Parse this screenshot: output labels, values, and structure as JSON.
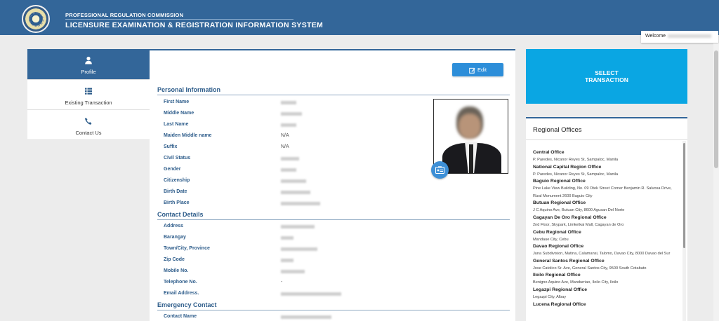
{
  "header": {
    "org_small": "PROFESSIONAL REGULATION COMMISSION",
    "org_big": "LICENSURE EXAMINATION & REGISTRATION INFORMATION SYSTEM",
    "welcome": "Welcome"
  },
  "nav": {
    "items": [
      {
        "label": "Profile",
        "icon": "user-icon"
      },
      {
        "label": "Existing Transaction",
        "icon": "list-icon"
      },
      {
        "label": "Contact Us",
        "icon": "phone-icon"
      }
    ]
  },
  "main": {
    "edit_label": "Edit",
    "personal_title": "Personal Information",
    "personal": [
      {
        "key": "First Name",
        "value": ""
      },
      {
        "key": "Middle Name",
        "value": ""
      },
      {
        "key": "Last Name",
        "value": ""
      },
      {
        "key": "Maiden Middle name",
        "value": "N/A"
      },
      {
        "key": "Suffix",
        "value": "N/A"
      },
      {
        "key": "Civil Status",
        "value": ""
      },
      {
        "key": "Gender",
        "value": ""
      },
      {
        "key": "Citizenship",
        "value": ""
      },
      {
        "key": "Birth Date",
        "value": ""
      },
      {
        "key": "Birth Place",
        "value": ""
      }
    ],
    "contact_title": "Contact Details",
    "contact": [
      {
        "key": "Address",
        "value": ""
      },
      {
        "key": "Barangay",
        "value": ""
      },
      {
        "key": "Town/City, Province",
        "value": ""
      },
      {
        "key": "Zip Code",
        "value": ""
      },
      {
        "key": "Mobile No.",
        "value": ""
      },
      {
        "key": "Telephone No.",
        "value": "-"
      },
      {
        "key": "Email Address.",
        "value": ""
      }
    ],
    "emergency_title": "Emergency Contact",
    "emergency": [
      {
        "key": "Contact Name",
        "value": ""
      }
    ]
  },
  "right": {
    "select_line1": "SELECT",
    "select_line2": "TRANSACTION",
    "regional_title": "Regional Offices",
    "offices": [
      {
        "name": "Central Office",
        "address": "P. Paredes, Nicanor Reyes St, Sampaloc, Manila"
      },
      {
        "name": "National Capital Region Office",
        "address": "P. Paredes, Nicanor Reyes St, Sampaloc, Manila"
      },
      {
        "name": "Baguio Regional Office",
        "address": "Pine Lake View Building, No. 09 Otek Street Corner Benjamin R. Salvosa Drive, Rizal Monument 2600 Baguio City"
      },
      {
        "name": "Butuan Regional Office",
        "address": "J C Aquino Ave, Butuan City, 8600 Agusan Del Norte"
      },
      {
        "name": "Cagayan De Oro Regional Office",
        "address": "2nd Floor, Skypark, Limketkai Mall, Cagayan de Oro"
      },
      {
        "name": "Cebu Regional Office",
        "address": "Mandaue City, Cebu"
      },
      {
        "name": "Davao Regional Office",
        "address": "Juna Subdivision, Matina, Calamansi, Talomo, Davao City, 8000 Davao del Sur"
      },
      {
        "name": "General Santos Regional Office",
        "address": "Jose Catolico Sr. Ave, General Santos City, 9500 South Cotabato"
      },
      {
        "name": "Iloilo Regional Office",
        "address": "Benigno Aquino Ave, Mandurriao, Iloilo City, Iloilo"
      },
      {
        "name": "Legazpi Regional Office",
        "address": "Legazpi City, Albay"
      },
      {
        "name": "Lucena Regional Office",
        "address": ""
      }
    ]
  },
  "colors": {
    "header": "#336699",
    "select_button": "#0aa6e3",
    "edit_button": "#2d8ed9",
    "section_title": "#2d5c8a"
  }
}
